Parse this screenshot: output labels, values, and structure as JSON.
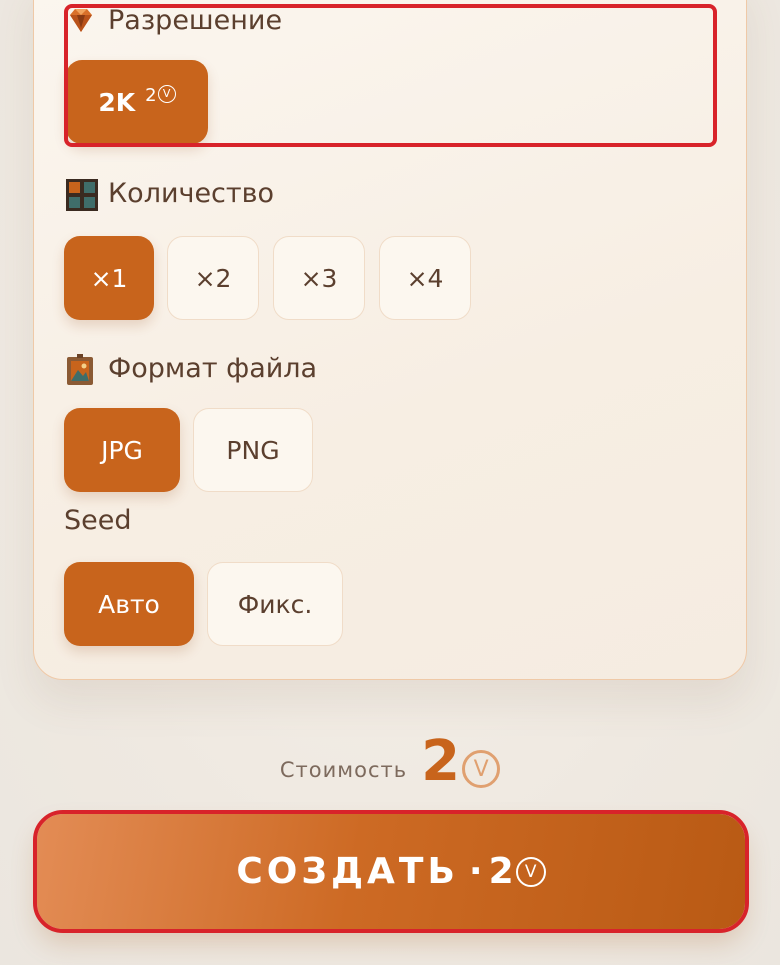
{
  "resolution": {
    "title": "Разрешение",
    "icon": "gem-icon",
    "options": [
      {
        "label": "2K",
        "cost": "2",
        "selected": true
      }
    ]
  },
  "quantity": {
    "title": "Количество",
    "icon": "grid-icon",
    "options": [
      {
        "label": "×1",
        "selected": true
      },
      {
        "label": "×2",
        "selected": false
      },
      {
        "label": "×3",
        "selected": false
      },
      {
        "label": "×4",
        "selected": false
      }
    ]
  },
  "format": {
    "title": "Формат файла",
    "icon": "picture-frame-icon",
    "options": [
      {
        "label": "JPG",
        "selected": true
      },
      {
        "label": "PNG",
        "selected": false
      }
    ]
  },
  "seed": {
    "title": "Seed",
    "options": [
      {
        "label": "Авто",
        "selected": true
      },
      {
        "label": "Фикс.",
        "selected": false
      }
    ]
  },
  "cost": {
    "label": "Стоимость",
    "value": "2",
    "currency_icon": "v-coin-icon"
  },
  "create_button": {
    "label": "СОЗДАТЬ",
    "separator": "·",
    "cost": "2"
  },
  "colors": {
    "accent": "#c8641c",
    "highlight": "#d8232a",
    "card_border": "#efc9a7"
  }
}
